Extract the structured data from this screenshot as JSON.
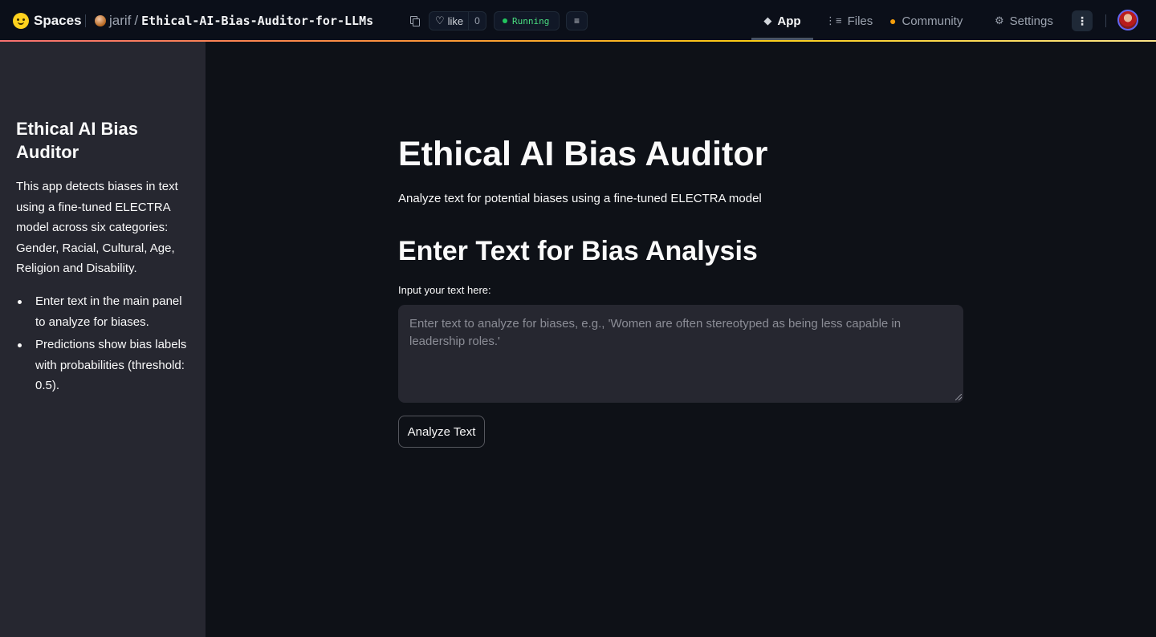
{
  "topbar": {
    "brand": "Spaces",
    "repo_owner": "jarif",
    "repo_separator": "/",
    "repo_name": "Ethical-AI-Bias-Auditor-for-LLMs",
    "like_label": "like",
    "like_count": "0",
    "status": "Running",
    "tabs": [
      {
        "label": "App",
        "icon": "cube-icon",
        "active": true
      },
      {
        "label": "Files",
        "icon": "files-icon",
        "active": false
      },
      {
        "label": "Community",
        "icon": "community-icon",
        "active": false
      },
      {
        "label": "Settings",
        "icon": "gear-icon",
        "active": false
      }
    ],
    "kebab_glyph": "⋮"
  },
  "sidebar": {
    "title": "Ethical AI Bias Auditor",
    "description": "This app detects biases in text using a fine-tuned ELECTRA model across six categories: Gender, Racial, Cultural, Age, Religion and Disability.",
    "items": [
      {
        "label": "Enter text in the main panel to analyze for biases."
      },
      {
        "label": "Predictions show bias labels with probabilities (threshold: 0.5)."
      }
    ]
  },
  "main": {
    "title": "Ethical AI Bias Auditor",
    "subtitle": "Analyze text for potential biases using a fine-tuned ELECTRA model",
    "section_heading": "Enter Text for Bias Analysis",
    "input_label": "Input your text here:",
    "input_value": "",
    "input_placeholder": "Enter text to analyze for biases, e.g., 'Women are often stereotyped as being less capable in leadership roles.'",
    "analyze_button": "Analyze Text"
  },
  "colors": {
    "page_bg": "#0e1117",
    "sidebar_bg": "#262730",
    "topbar_bg": "#0b0f19",
    "status_green": "#4ade80",
    "accent_gradient_start": "#f87171",
    "accent_gradient_end": "#fde68a"
  }
}
